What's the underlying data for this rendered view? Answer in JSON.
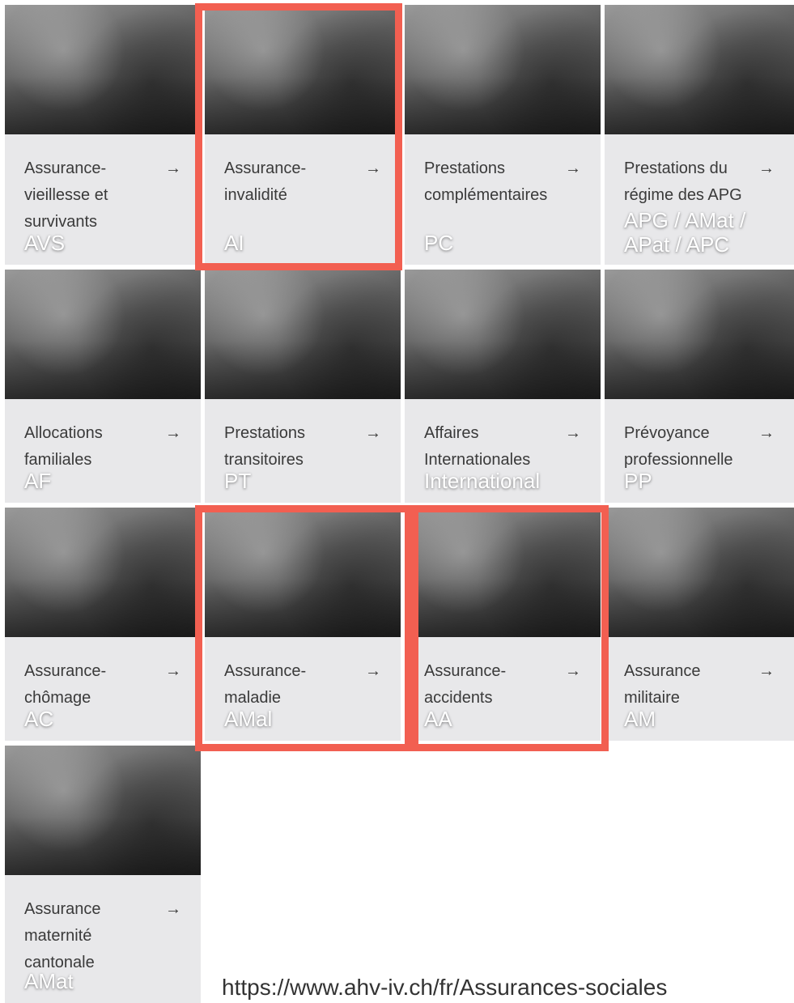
{
  "tiles": [
    {
      "code": "AVS",
      "description": "Assurance-vieillesse et survivants"
    },
    {
      "code": "AI",
      "description": "Assurance-invalidité"
    },
    {
      "code": "PC",
      "description": "Prestations complémentaires"
    },
    {
      "code": "APG / AMat / APat / APC",
      "description": "Prestations du régime des APG"
    },
    {
      "code": "AF",
      "description": "Allocations familiales"
    },
    {
      "code": "PT",
      "description": "Prestations transitoires"
    },
    {
      "code": "International",
      "description": "Affaires Internationales"
    },
    {
      "code": "PP",
      "description": "Prévoyance professionnelle"
    },
    {
      "code": "AC",
      "description": "Assurance-chômage"
    },
    {
      "code": "AMal",
      "description": "Assurance-maladie"
    },
    {
      "code": "AA",
      "description": "Assurance-accidents"
    },
    {
      "code": "AM",
      "description": "Assurance militaire"
    },
    {
      "code": "AMat",
      "description": "Assurance maternité cantonale"
    }
  ],
  "arrow_glyph": "→",
  "highlight_color": "#f25f51",
  "footer_url": "https://www.ahv-iv.ch/fr/Assurances-sociales"
}
